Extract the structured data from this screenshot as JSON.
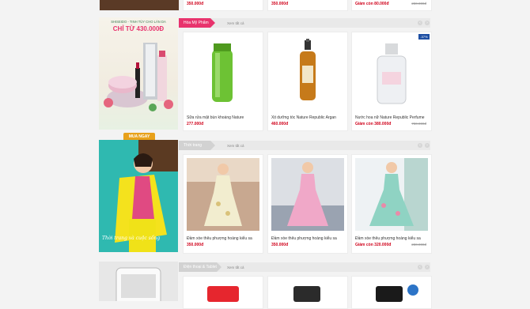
{
  "top_row": {
    "prices": [
      "350.000đ",
      "350.000đ",
      "Giảm còn 80.000đ"
    ],
    "old_price": "280.000đ"
  },
  "sections": [
    {
      "tab_label": "Hóa Mỹ Phẩm",
      "see_all": "Xem tất cả",
      "tab_color": "#e8336d",
      "banner": {
        "title": "SHISEIDO - TINH TÚY CHO LÀN DA",
        "headline": "CHỈ TỪ 430.000Đ",
        "button": "MUA NGAY"
      },
      "products": [
        {
          "name": "Sữa rửa mặt bùn khoáng Nature",
          "price": "277.000đ",
          "old_price": "",
          "badge": ""
        },
        {
          "name": "Xịt dưỡng tóc Nature Republic Argan",
          "price": "460.000đ",
          "old_price": "",
          "badge": ""
        },
        {
          "name": "Nước hoa nữ Nature Republic Perfume",
          "price": "Giảm còn 380.000đ",
          "old_price": "780.000đ",
          "badge": "-37%"
        }
      ]
    },
    {
      "tab_label": "Thời trang",
      "see_all": "Xem tất cả",
      "tab_color": "#cfcfcf",
      "banner": {
        "script_text": "Thời trang và cuộc sống"
      },
      "products": [
        {
          "name": "Đầm xòe thêu phượng hoàng kiểu sa",
          "price": "350.000đ",
          "old_price": ""
        },
        {
          "name": "Đầm xòe thêu phượng hoàng kiểu sa",
          "price": "350.000đ",
          "old_price": ""
        },
        {
          "name": "Đầm xòe thêu phượng hoàng kiểu sa",
          "price": "Giảm còn 320.000đ",
          "old_price": "280.000đ"
        }
      ]
    },
    {
      "tab_label": "Điện thoại & Tablet",
      "see_all": "Xem tất cả",
      "tab_color": "#cfcfcf"
    }
  ],
  "colors": {
    "accent_price": "#d0021b",
    "tab_pink": "#e8336d",
    "badge_blue": "#1e4fa3"
  }
}
